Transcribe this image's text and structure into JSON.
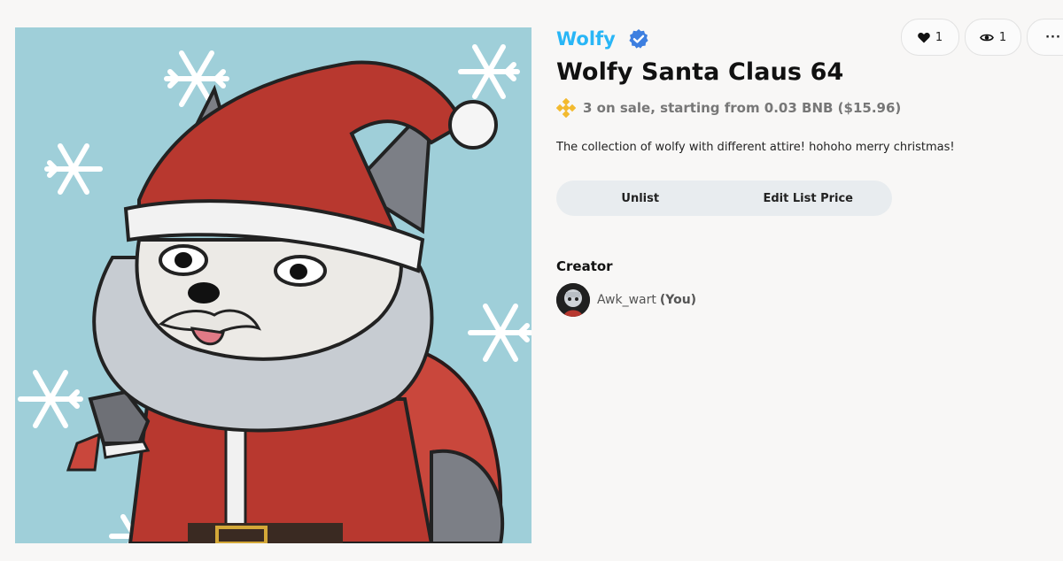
{
  "collection": {
    "name": "Wolfy",
    "verified_icon": "verified-badge-icon"
  },
  "item": {
    "title": "Wolfy Santa Claus 64",
    "sale_text": "3 on sale, starting from 0.03 BNB ($15.96)",
    "currency_icon": "bnb-icon",
    "description": "The collection of wolfy with different attire! hohoho merry christmas!"
  },
  "buttons": {
    "unlist": "Unlist",
    "edit_price": "Edit List Price"
  },
  "creator": {
    "label": "Creator",
    "name": "Awk_wart",
    "you_tag": "(You)"
  },
  "stats": {
    "likes": "1",
    "views": "1",
    "more": "···"
  },
  "colors": {
    "accent": "#29b6f6",
    "verified": "#3d7fe0",
    "bnb": "#f3ba2f",
    "artwork_bg": "#9fcfd9"
  }
}
